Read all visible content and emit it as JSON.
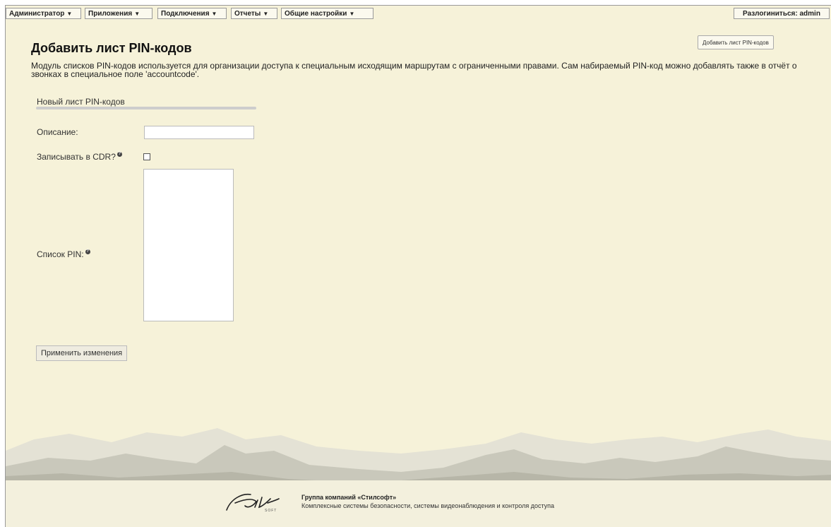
{
  "menu": {
    "items": [
      {
        "label": "Администратор"
      },
      {
        "label": "Приложения"
      },
      {
        "label": "Подключения"
      },
      {
        "label": "Отчеты"
      },
      {
        "label": "Общие настройки"
      }
    ],
    "caret": "▼",
    "logout": "Разлогиниться: admin"
  },
  "page": {
    "title": "Добавить лист PIN-кодов",
    "help_button": "Добавить лист PIN-кодов",
    "description": "Модуль списков PIN-кодов используется для организации доступа к специальным исходящим маршрутам с ограниченными правами. Сам набираемый PIN-код можно добавлять также в отчёт о звонках в специальное поле 'accountcode'."
  },
  "form": {
    "section_title": "Новый лист PIN-кодов",
    "description_label": "Описание:",
    "description_value": "",
    "record_cdr_label": "Записывать в CDR?",
    "record_cdr_checked": false,
    "pin_list_label": "Список PIN:",
    "pin_list_value": "",
    "help_mark": "?",
    "apply_label": "Применить изменения"
  },
  "footer": {
    "company": "Группа компаний «Стилсофт»",
    "tagline": "Комплексные системы безопасности, системы видеонаблюдения и контроля доступа"
  },
  "colors": {
    "background": "#f6f2d9",
    "mountain_light": "#dcdbcf",
    "mountain_dark": "#b5b4a6"
  },
  "icons": [
    "chevron-down-icon",
    "help-icon",
    "stilsoft-logo"
  ]
}
